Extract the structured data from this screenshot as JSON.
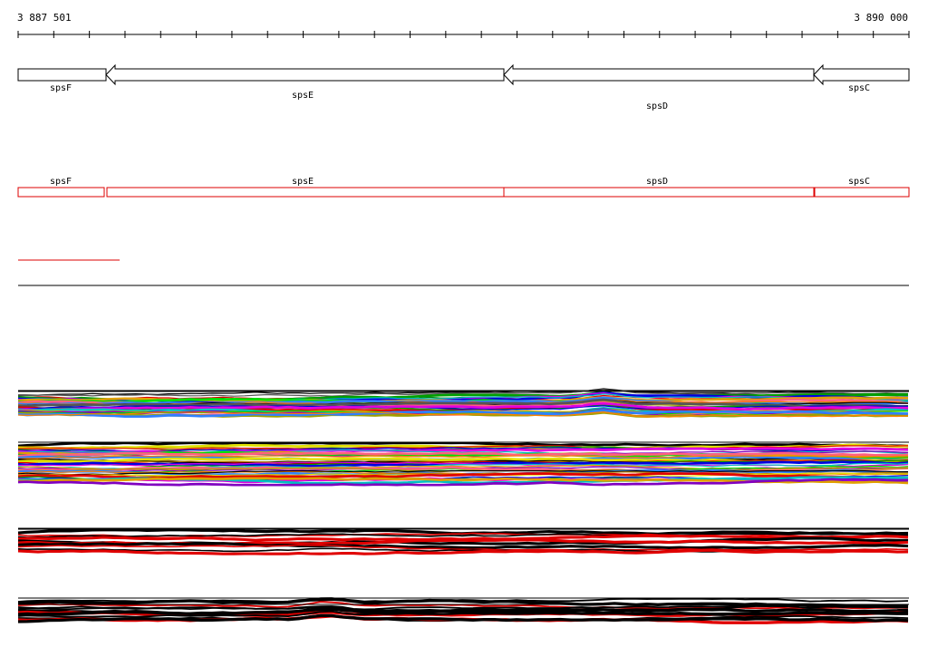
{
  "ruler": {
    "start_label": "3 887 501",
    "end_label": "3 890 000"
  },
  "gene_track": {
    "genes": [
      {
        "name": "spsF",
        "strand": "-"
      },
      {
        "name": "spsE",
        "strand": "-"
      },
      {
        "name": "spsD",
        "strand": "-"
      },
      {
        "name": "spsC",
        "strand": "-"
      }
    ]
  },
  "cds_track": {
    "genes": [
      {
        "name": "spsF"
      },
      {
        "name": "spsE"
      },
      {
        "name": "spsD"
      },
      {
        "name": "spsC"
      }
    ]
  },
  "colors": {
    "feature_outline": "#000000",
    "cds_outline": "#dd0000",
    "expression_palette": [
      "#e00000",
      "#00a000",
      "#0000e0",
      "#e000e0",
      "#00c0c0",
      "#e0a000",
      "#8000c0",
      "#00e000",
      "#ff6080",
      "#a0a000",
      "#3080ff",
      "#ff8000"
    ]
  }
}
